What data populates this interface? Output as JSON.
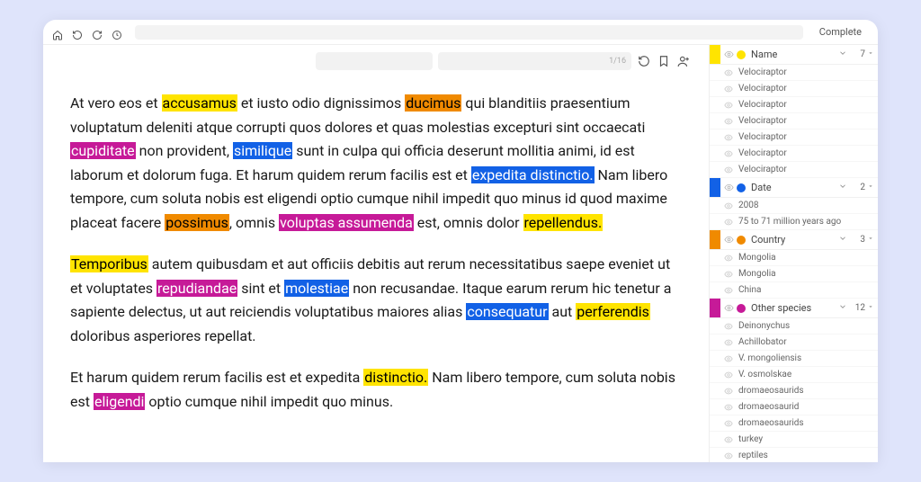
{
  "title_button": "Complete",
  "find": {
    "count": "1/16"
  },
  "paragraphs": [
    [
      {
        "t": "At vero eos et "
      },
      {
        "t": "accusamus",
        "c": "yellow"
      },
      {
        "t": " et iusto odio dignissimos "
      },
      {
        "t": "ducimus",
        "c": "orange"
      },
      {
        "t": " qui blanditiis praesentium voluptatum deleniti atque corrupti quos dolores et quas molestias excepturi sint occaecati "
      },
      {
        "t": "cupiditate",
        "c": "magenta"
      },
      {
        "t": " non provident, "
      },
      {
        "t": "similique",
        "c": "blue"
      },
      {
        "t": " sunt in culpa qui officia deserunt mollitia animi, id est laborum et dolorum fuga. Et harum quidem rerum facilis est et "
      },
      {
        "t": "expedita distinctio.",
        "c": "blue"
      },
      {
        "t": " Nam libero tempore, cum soluta nobis est eligendi optio cumque nihil impedit quo minus id quod maxime placeat facere "
      },
      {
        "t": "possimus",
        "c": "orange"
      },
      {
        "t": ", omnis "
      },
      {
        "t": "voluptas assumenda",
        "c": "magenta"
      },
      {
        "t": " est, omnis dolor "
      },
      {
        "t": "repellendus.",
        "c": "yellow"
      }
    ],
    [
      {
        "t": "Temporibus",
        "c": "yellow"
      },
      {
        "t": " autem quibusdam et aut officiis debitis aut rerum necessitatibus saepe eveniet ut et voluptates "
      },
      {
        "t": "repudiandae",
        "c": "magenta"
      },
      {
        "t": " sint et "
      },
      {
        "t": "molestiae",
        "c": "blue"
      },
      {
        "t": " non recusandae. Itaque earum rerum hic tenetur a sapiente delectus, ut aut reiciendis voluptatibus maiores alias "
      },
      {
        "t": "consequatur",
        "c": "blue"
      },
      {
        "t": " aut "
      },
      {
        "t": "perferendis",
        "c": "yellow"
      },
      {
        "t": " doloribus asperiores repellat."
      }
    ],
    [
      {
        "t": "Et harum quidem rerum facilis est et expedita "
      },
      {
        "t": "distinctio.",
        "c": "yellow"
      },
      {
        "t": " Nam libero tempore, cum soluta nobis est "
      },
      {
        "t": "eligendi",
        "c": "magenta"
      },
      {
        "t": " optio cumque nihil impedit quo minus."
      }
    ]
  ],
  "categories": [
    {
      "name": "Name",
      "color": "yellow",
      "count": "7",
      "items": [
        "Velociraptor",
        "Velociraptor",
        "Velociraptor",
        "Velociraptor",
        "Velociraptor",
        "Velociraptor",
        "Velociraptor"
      ]
    },
    {
      "name": "Date",
      "color": "blue",
      "count": "2",
      "items": [
        "2008",
        "75 to 71 million years ago"
      ]
    },
    {
      "name": "Country",
      "color": "orange",
      "count": "3",
      "items": [
        "Mongolia",
        "Mongolia",
        "China"
      ]
    },
    {
      "name": "Other species",
      "color": "magenta",
      "count": "12",
      "items": [
        "Deinonychus",
        "Achillobator",
        "V. mongoliensis",
        "V. osmolskae",
        "dromaeosaurids",
        "dromaeosaurid",
        "dromaeosaurids",
        "turkey",
        "reptiles"
      ]
    }
  ]
}
